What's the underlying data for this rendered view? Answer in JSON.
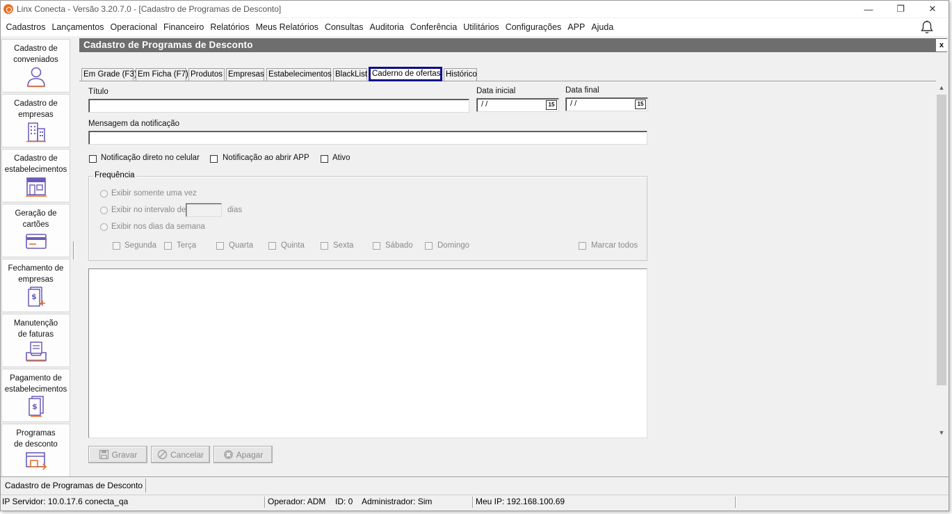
{
  "window": {
    "title": "Linx Conecta - Versão 3.20.7.0 - [Cadastro de Programas de Desconto]",
    "controls": [
      "—",
      "❐",
      "✕"
    ]
  },
  "menu": [
    "Cadastros",
    "Lançamentos",
    "Operacional",
    "Financeiro",
    "Relatórios",
    "Meus Relatórios",
    "Consultas",
    "Auditoria",
    "Conferência",
    "Utilitários",
    "Configurações",
    "APP",
    "Ajuda"
  ],
  "sidebar": {
    "items": [
      {
        "label_1": "Cadastro de",
        "label_2": "conveniados",
        "icon": "person-icon"
      },
      {
        "label_1": "Cadastro de",
        "label_2": "empresas",
        "icon": "building-icon"
      },
      {
        "label_1": "Cadastro de",
        "label_2": "estabelecimentos",
        "icon": "store-icon"
      },
      {
        "label_1": "Geração de",
        "label_2": "cartões",
        "icon": "card-icon"
      },
      {
        "label_1": "Fechamento de",
        "label_2": "empresas",
        "icon": "invoice-add-icon"
      },
      {
        "label_1": "Manutenção",
        "label_2": "de faturas",
        "icon": "inbox-tray-icon"
      },
      {
        "label_1": "Pagamento de",
        "label_2": "estabelecimentos",
        "icon": "payment-doc-icon"
      },
      {
        "label_1": "Programas",
        "label_2": "de desconto",
        "icon": "discount-program-icon"
      }
    ]
  },
  "form": {
    "header": "Cadastro de Programas de Desconto",
    "close_label": "x"
  },
  "tabs": [
    "Em Grade (F3)",
    "Em Ficha (F7)",
    "Produtos",
    "Empresas",
    "Estabelecimentos",
    "BlackList",
    "Caderno de ofertas",
    "Histórico"
  ],
  "fields": {
    "titulo_label": "Título",
    "titulo_value": "",
    "data_inicial_label": "Data inicial",
    "data_inicial_value": " /  /",
    "data_final_label": "Data final",
    "data_final_value": " /  /",
    "calendar_label": "15",
    "mensagem_label": "Mensagem da notificação",
    "mensagem_value": ""
  },
  "checks": {
    "notif_celular": "Notificação direto no celular",
    "notif_app": "Notificação ao abrir APP",
    "ativo": "Ativo"
  },
  "frequencia": {
    "title": "Frequência",
    "opt_once": "Exibir somente uma vez",
    "opt_interval": "Exibir no intervalo de",
    "interval_unit": "dias",
    "opt_weekdays": "Exibir nos dias da semana",
    "days": [
      "Segunda",
      "Terça",
      "Quarta",
      "Quinta",
      "Sexta",
      "Sábado",
      "Domingo"
    ],
    "mark_all": "Marcar todos"
  },
  "buttons": {
    "save": "Gravar",
    "cancel": "Cancelar",
    "delete": "Apagar"
  },
  "taskbar": {
    "tab": "Cadastro de Programas de Desconto"
  },
  "status": {
    "server": "IP Servidor: 10.0.17.6 conecta_qa",
    "operator": "Operador: ADM",
    "id": "ID: 0",
    "admin": "Administrador: Sim",
    "ip": "Meu IP: 192.168.100.69"
  },
  "colors": {
    "accent_orange": "#e8702a",
    "icon_purple": "#6b5bb8",
    "active_tab_border": "#0d0d8a",
    "header_gray": "#6e6e6e"
  }
}
